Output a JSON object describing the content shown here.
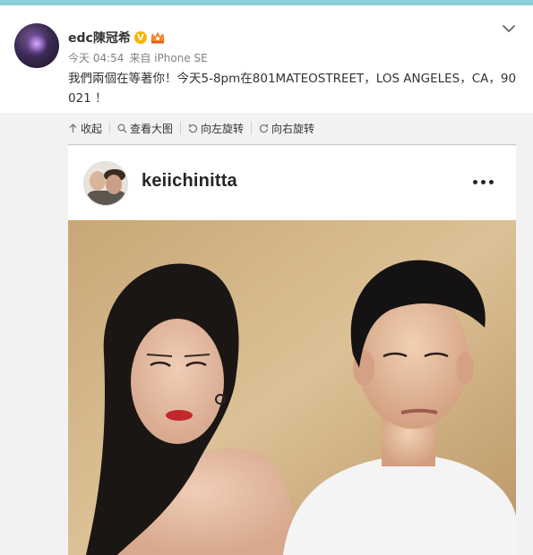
{
  "post": {
    "username": "edc陳冠希",
    "verified_badge": "V",
    "time": "今天 04:54",
    "source": "来自 iPhone SE",
    "text": "我們兩個在等著你！今天5-8pm在801MATEOSTREET，LOS ANGELES，CA，90021 ！",
    "icons": [
      "verified-badge-icon",
      "crown-icon",
      "chevron-down-icon"
    ]
  },
  "toolbar": {
    "collapse_label": "收起",
    "view_large_label": "查看大图",
    "rotate_left_label": "向左旋转",
    "rotate_right_label": "向右旋转",
    "icons": [
      "arrow-up-icon",
      "magnifier-icon",
      "rotate-left-icon",
      "rotate-right-icon"
    ]
  },
  "instagram_card": {
    "username": "keiichinitta",
    "icons": [
      "more-dots-icon"
    ]
  },
  "colors": {
    "top_accent": "#8ccfd8",
    "text_main": "#333333",
    "text_meta": "#808080",
    "media_bg": "#f2f2f5",
    "badge_gold": "#f7b500"
  }
}
